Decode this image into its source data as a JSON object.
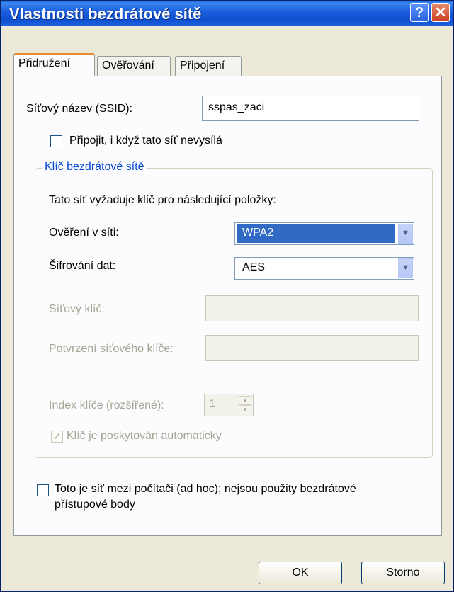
{
  "window": {
    "title": "Vlastnosti bezdrátové sítě",
    "help_glyph": "?",
    "close_glyph": "✕"
  },
  "tabs": [
    {
      "label": "Přidružení",
      "active": true
    },
    {
      "label": "Ověřování",
      "active": false
    },
    {
      "label": "Připojení",
      "active": false
    }
  ],
  "association": {
    "ssid_label": "Síťový název (SSID):",
    "ssid_value": "sspas_zaci",
    "connect_even_if_not_broadcasting": {
      "label": "Připojit, i když tato síť nevysílá",
      "checked": false
    },
    "wireless_key_group": {
      "title": "Klíč bezdrátové sítě",
      "description": "Tato síť vyžaduje klíč pro následující položky:",
      "auth_label": "Ověření v síti:",
      "auth_value": "WPA2",
      "encryption_label": "Šifrování dat:",
      "encryption_value": "AES",
      "network_key_label": "Síťový klíč:",
      "network_key_value": "",
      "confirm_key_label": "Potvrzení síťového klíče:",
      "confirm_key_value": "",
      "key_index_label": "Index klíče (rozšířené):",
      "key_index_value": "1",
      "key_auto": {
        "label": "Klíč je poskytován automaticky",
        "checked": true,
        "check_glyph": "✓"
      }
    },
    "adhoc": {
      "label_line1": "Toto je síť mezi počítači (ad hoc); nejsou použity bezdrátové",
      "label_line2": "přístupové body",
      "checked": false
    }
  },
  "buttons": {
    "ok": "OK",
    "cancel": "Storno"
  },
  "icons": {
    "dropdown": "chevron-down-icon",
    "spin_up": "spin-up-icon",
    "spin_down": "spin-down-icon"
  },
  "colors": {
    "titlebar": "#0f4fd0",
    "selection": "#316ac5",
    "group_title": "#0046d5",
    "disabled_text": "#a5a595"
  }
}
